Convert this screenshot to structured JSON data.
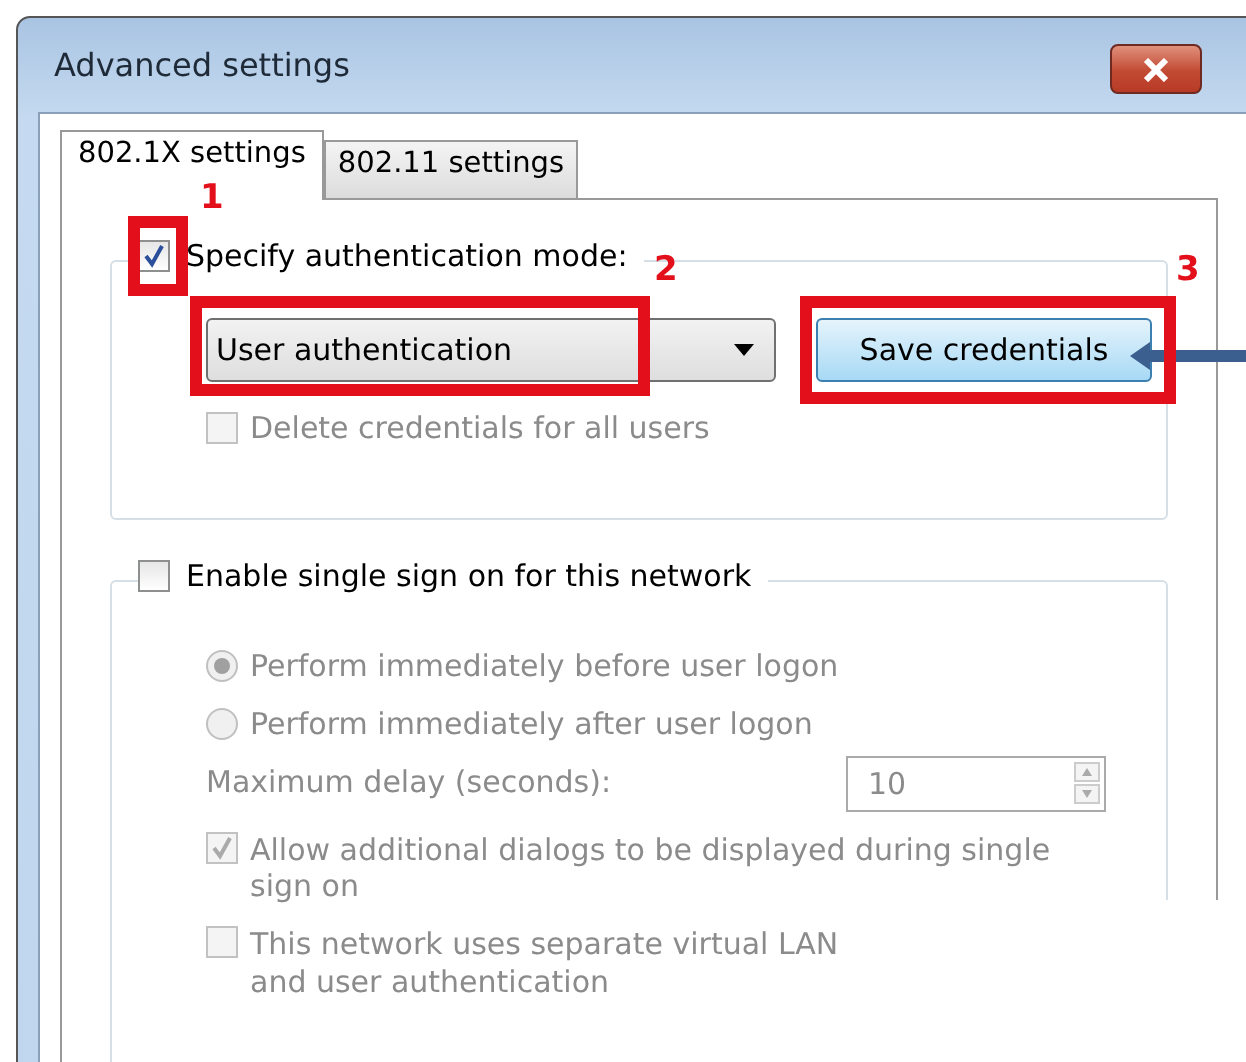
{
  "window": {
    "title": "Advanced settings"
  },
  "tabs": [
    {
      "label": "802.1X settings",
      "selected": true
    },
    {
      "label": "802.11 settings",
      "selected": false
    }
  ],
  "auth_group": {
    "checkbox": {
      "label": "Specify authentication mode:",
      "checked": true
    },
    "mode_dropdown": {
      "value": "User authentication"
    },
    "save_button": "Save credentials",
    "delete_checkbox": {
      "label": "Delete credentials for all users",
      "checked": false,
      "disabled": true
    }
  },
  "sso_group": {
    "checkbox": {
      "label": "Enable single sign on for this network",
      "checked": false
    },
    "options": [
      {
        "label": "Perform immediately before user logon",
        "selected": true,
        "disabled": true
      },
      {
        "label": "Perform immediately after user logon",
        "selected": false,
        "disabled": true
      }
    ],
    "delay": {
      "label": "Maximum delay (seconds):",
      "value": "10",
      "disabled": true
    },
    "checkboxes": [
      {
        "label": "Allow additional dialogs to be displayed during single sign on",
        "checked": true,
        "disabled": true
      },
      {
        "label": "This network uses separate virtual LAN",
        "label_2": "and user authentication",
        "checked": false,
        "disabled": true
      }
    ]
  },
  "annotations": [
    {
      "label": "1"
    },
    {
      "label": "2"
    },
    {
      "label": "3"
    }
  ]
}
